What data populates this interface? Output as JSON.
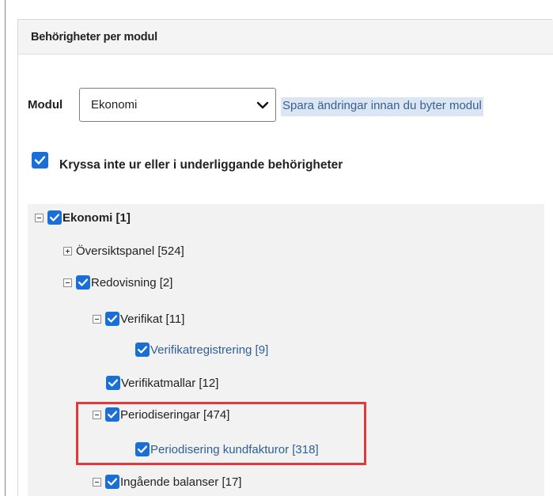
{
  "panel": {
    "title": "Behörigheter per modul"
  },
  "module_select": {
    "label": "Modul",
    "value": "Ekonomi",
    "hint": "Spara ändringar innan du byter modul"
  },
  "keep_checkbox": {
    "checked": true,
    "label": "Kryssa inte ur eller i underliggande behörigheter"
  },
  "tree": [
    {
      "label": "Ekonomi [1]",
      "toggle": "minus",
      "checked": true,
      "bold": true
    },
    {
      "label": "Översiktspanel [524]",
      "toggle": "plus",
      "checked": false,
      "bold": false
    },
    {
      "label": "Redovisning [2]",
      "toggle": "minus",
      "checked": true,
      "bold": false
    },
    {
      "label": "Verifikat [11]",
      "toggle": "minus",
      "checked": true,
      "bold": false
    },
    {
      "label": "Verifikatregistrering [9]",
      "toggle": "none",
      "checked": true,
      "bold": false
    },
    {
      "label": "Verifikatmallar [12]",
      "toggle": "none",
      "checked": true,
      "bold": false
    },
    {
      "label": "Periodiseringar [474]",
      "toggle": "minus",
      "checked": true,
      "bold": false
    },
    {
      "label": "Periodisering kundfakturor [318]",
      "toggle": "none",
      "checked": true,
      "bold": false
    },
    {
      "label": "Ingående balanser [17]",
      "toggle": "minus",
      "checked": true,
      "bold": false
    }
  ],
  "colors": {
    "checkbox": "#1a6fd6",
    "highlight_border": "#e0393e",
    "hint_background": "#dbe6f4",
    "tree_background": "#f2f2f2"
  }
}
